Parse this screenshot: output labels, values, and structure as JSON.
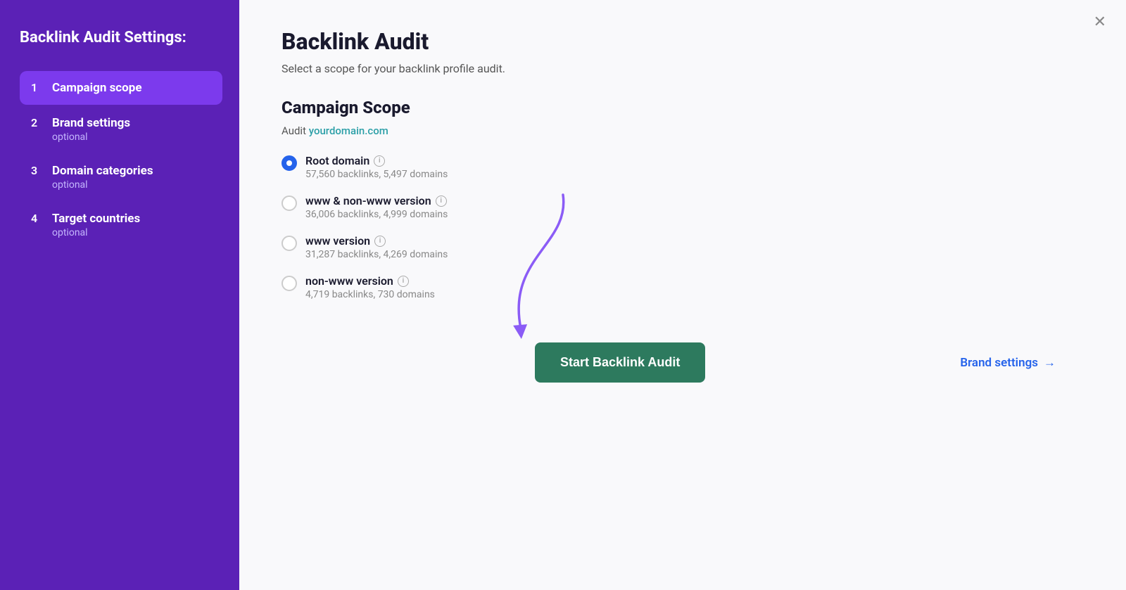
{
  "sidebar": {
    "title": "Backlink Audit Settings:",
    "items": [
      {
        "number": "1",
        "label": "Campaign scope",
        "sub": null,
        "active": true
      },
      {
        "number": "2",
        "label": "Brand settings",
        "sub": "optional",
        "active": false
      },
      {
        "number": "3",
        "label": "Domain categories",
        "sub": "optional",
        "active": false
      },
      {
        "number": "4",
        "label": "Target countries",
        "sub": "optional",
        "active": false
      }
    ]
  },
  "main": {
    "page_title": "Backlink Audit",
    "page_subtitle": "Select a scope for your backlink profile audit.",
    "section_title": "Campaign Scope",
    "audit_label": "Audit ",
    "audit_domain": "yourdomain.com",
    "radio_options": [
      {
        "id": "root-domain",
        "label": "Root domain",
        "desc": "57,560 backlinks, 5,497 domains",
        "selected": true,
        "has_info": true
      },
      {
        "id": "www-non-www",
        "label": "www & non-www version",
        "desc": "36,006 backlinks, 4,999 domains",
        "selected": false,
        "has_info": true
      },
      {
        "id": "www-version",
        "label": "www version",
        "desc": "31,287 backlinks, 4,269 domains",
        "selected": false,
        "has_info": true
      },
      {
        "id": "non-www-version",
        "label": "non-www version",
        "desc": "4,719 backlinks, 730 domains",
        "selected": false,
        "has_info": true
      }
    ],
    "start_button_label": "Start Backlink Audit",
    "brand_settings_link": "Brand settings",
    "brand_settings_arrow": "→",
    "close_icon": "✕",
    "info_icon_label": "i"
  }
}
